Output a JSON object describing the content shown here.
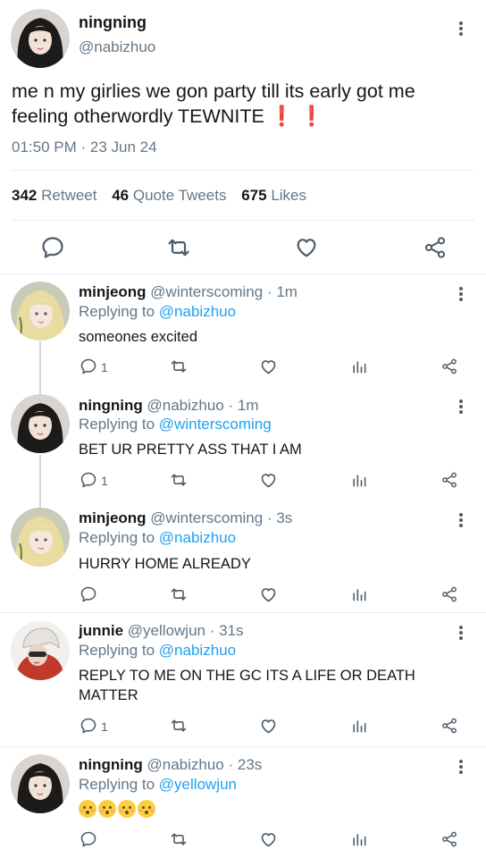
{
  "main_tweet": {
    "name": "ningning",
    "handle": "@nabizhuo",
    "text": "me n my girlies we gon party till its early got me feeling otherwordly TEWNITE",
    "emoji_text": "❗ ❗",
    "timestamp": "01:50 PM · 23 Jun 24",
    "retweets_count": "342",
    "retweets_label": "Retweet",
    "quotes_count": "46",
    "quotes_label": "Quote Tweets",
    "likes_count": "675",
    "likes_label": "Likes"
  },
  "replies": [
    {
      "name": "minjeong",
      "handle": "@winterscoming",
      "time": "· 1m",
      "replying_label": "Replying to",
      "replying_to": "@nabizhuo",
      "text": "someones excited",
      "reply_count": "1"
    },
    {
      "name": "ningning",
      "handle": "@nabizhuo",
      "time": "· 1m",
      "replying_label": "Replying to",
      "replying_to": "@winterscoming",
      "text": "BET UR PRETTY ASS THAT I AM",
      "reply_count": "1"
    },
    {
      "name": "minjeong",
      "handle": "@winterscoming",
      "time": "· 3s",
      "replying_label": "Replying to",
      "replying_to": "@nabizhuo",
      "text": "HURRY HOME ALREADY",
      "reply_count": ""
    },
    {
      "name": "junnie",
      "handle": "@yellowjun",
      "time": "· 31s",
      "replying_label": "Replying to",
      "replying_to": "@nabizhuo",
      "text": "REPLY TO ME ON THE GC ITS A LIFE OR DEATH MATTER",
      "reply_count": "1"
    },
    {
      "name": "ningning",
      "handle": "@nabizhuo",
      "time": "· 23s",
      "replying_label": "Replying to",
      "replying_to": "@yellowjun",
      "text": "",
      "emoji": "kissing-blushing-face x4",
      "reply_count": ""
    }
  ],
  "icons": [
    "more-vertical-icon",
    "reply-icon",
    "retweet-icon",
    "like-icon",
    "share-icon",
    "analytics-icon"
  ],
  "colors": {
    "text": "#14171a",
    "muted": "#657786",
    "link": "#1da1f2",
    "alert": "#e0173a",
    "divider": "#e6ecf0"
  }
}
